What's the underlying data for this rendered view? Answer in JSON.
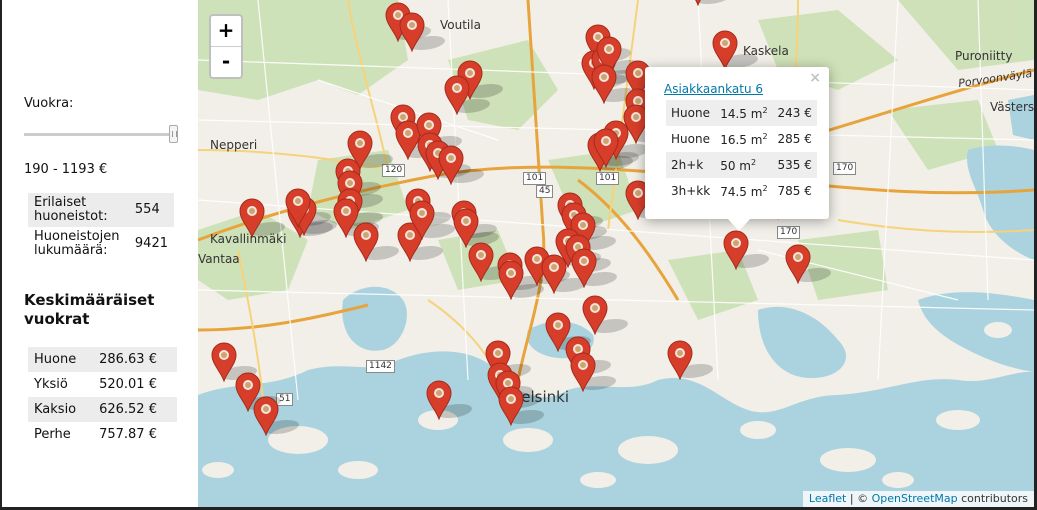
{
  "sidebar": {
    "rent_label": "Vuokra:",
    "range_text": "190 - 1193 €",
    "slider": {
      "min_fraction": 0.0,
      "max_fraction": 1.0
    },
    "stats": [
      {
        "label": "Erilaiset huoneistot:",
        "value": "554"
      },
      {
        "label": "Huoneistojen lukumäärä:",
        "value": "9421"
      }
    ],
    "avg_title": "Keskimääräiset vuokrat",
    "averages": [
      {
        "label": "Huone",
        "value": "286.63 €"
      },
      {
        "label": "Yksiö",
        "value": "520.01 €"
      },
      {
        "label": "Kaksio",
        "value": "626.52 €"
      },
      {
        "label": "Perhe",
        "value": "757.87 €"
      }
    ]
  },
  "map": {
    "zoom_in": "+",
    "zoom_out": "-",
    "place_labels": [
      "Voutila",
      "Kaskela",
      "Puroniitty",
      "Nepperi",
      "Kavallinmäki",
      "Vantaa",
      "Helsinki",
      "Västers",
      "Porvoonväylä"
    ],
    "road_numbers": [
      "120",
      "101",
      "45",
      "101",
      "170",
      "170",
      "1142",
      "51"
    ],
    "popup": {
      "close": "×",
      "address": "Asiakkaankatu 6",
      "rows": [
        {
          "type": "Huone",
          "area": "14.5 m",
          "unit": "2",
          "rent": "243 €"
        },
        {
          "type": "Huone",
          "area": "16.5 m",
          "unit": "2",
          "rent": "285 €"
        },
        {
          "type": "2h+k",
          "area": "50 m",
          "unit": "2",
          "rent": "535 €"
        },
        {
          "type": "3h+kk",
          "area": "74.5 m",
          "unit": "2",
          "rent": "785 €"
        }
      ]
    },
    "attribution": {
      "leaflet": "Leaflet",
      "sep": " | © ",
      "osm": "OpenStreetMap",
      "suffix": " contributors"
    },
    "marker_color": "#d63e2a"
  }
}
